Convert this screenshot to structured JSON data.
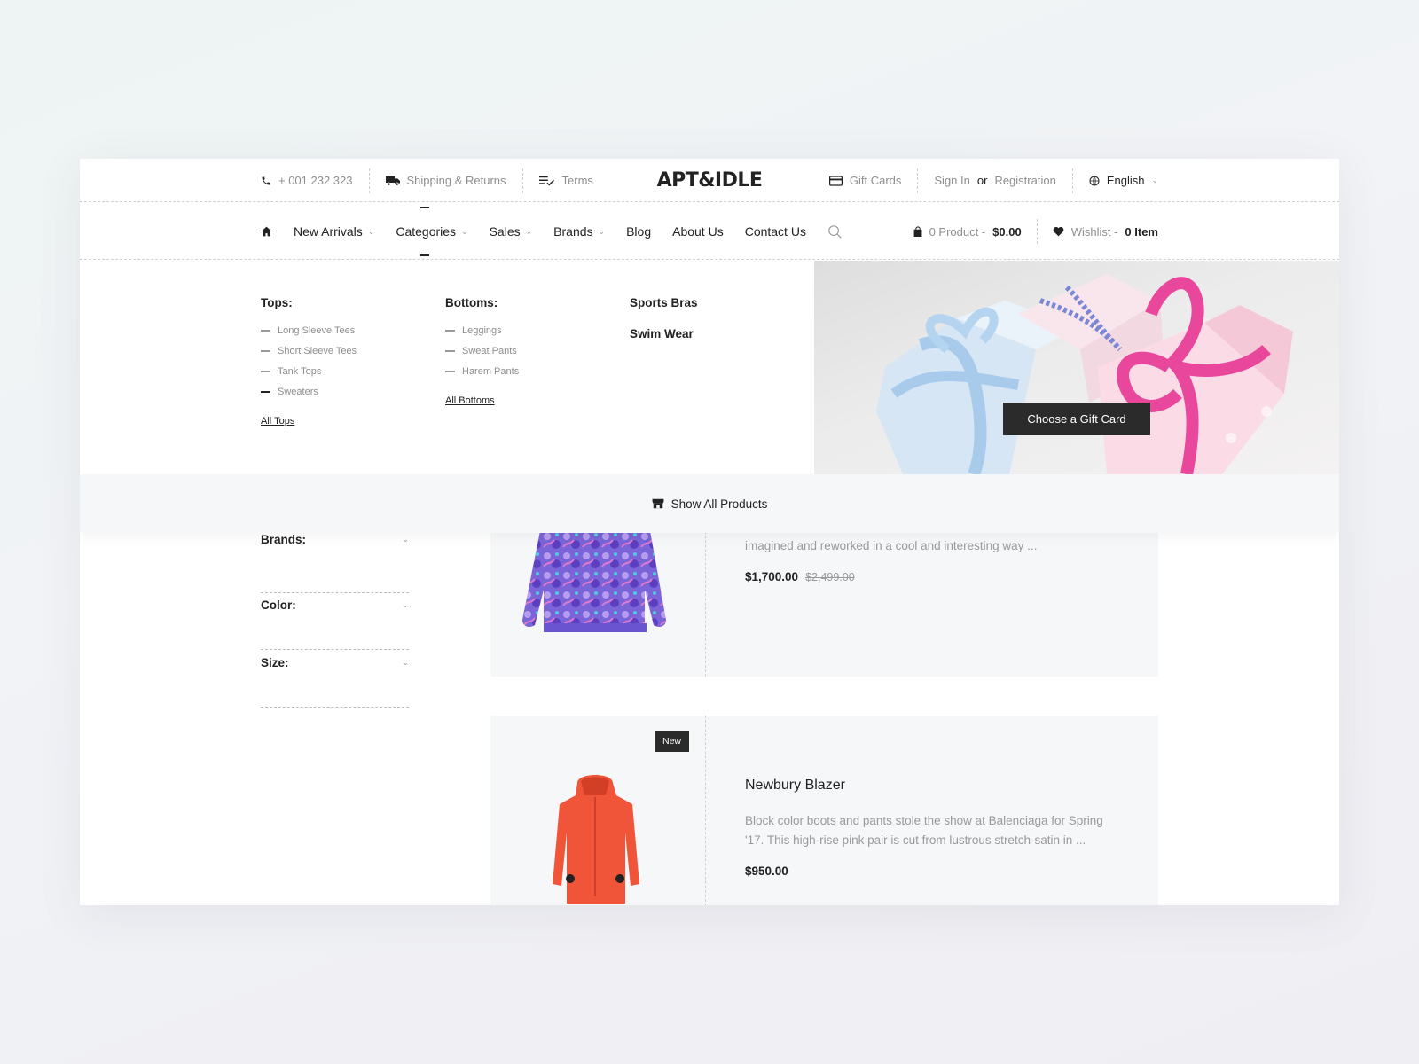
{
  "topbar": {
    "phone": "+ 001 232 323",
    "shipping": "Shipping & Returns",
    "terms": "Terms",
    "logo": "APT&IDLE",
    "gift_cards": "Gift Cards",
    "sign_in": "Sign In",
    "or": "or",
    "registration": "Registration",
    "language": "English"
  },
  "nav": {
    "items": [
      {
        "label": "New Arrivals"
      },
      {
        "label": "Categories"
      },
      {
        "label": "Sales"
      },
      {
        "label": "Brands"
      },
      {
        "label": "Blog"
      },
      {
        "label": "About Us"
      },
      {
        "label": "Contact Us"
      }
    ],
    "cart_label": "0 Product -",
    "cart_total": "$0.00",
    "wishlist_label": "Wishlist -",
    "wishlist_count": "0 Item"
  },
  "mega": {
    "tops": {
      "heading": "Tops:",
      "items": [
        "Long Sleeve Tees",
        "Short Sleeve Tees",
        "Tank Tops",
        "Sweaters"
      ],
      "all": "All Tops"
    },
    "bottoms": {
      "heading": "Bottoms:",
      "items": [
        "Leggings",
        "Sweat Pants",
        "Harem Pants"
      ],
      "all": "All Bottoms"
    },
    "other": [
      "Sports Bras",
      "Swim Wear"
    ],
    "promo_button": "Choose a Gift Card",
    "show_all": "Show All Products"
  },
  "filters": [
    "Brands:",
    "Color:",
    "Size:"
  ],
  "products": [
    {
      "title": "",
      "desc": "Monse's Spring '17 collection is filled with classic wardrobe staples, re-imagined and reworked in a cool and interesting way ...",
      "price": "$1,700.00",
      "old_price": "$2,499.00"
    },
    {
      "badge": "New",
      "title": "Newbury Blazer",
      "desc": "Block color boots and pants stole the show at Balenciaga for Spring '17. This high-rise pink pair is cut from lustrous stretch-satin in ...",
      "price": "$950.00"
    }
  ]
}
